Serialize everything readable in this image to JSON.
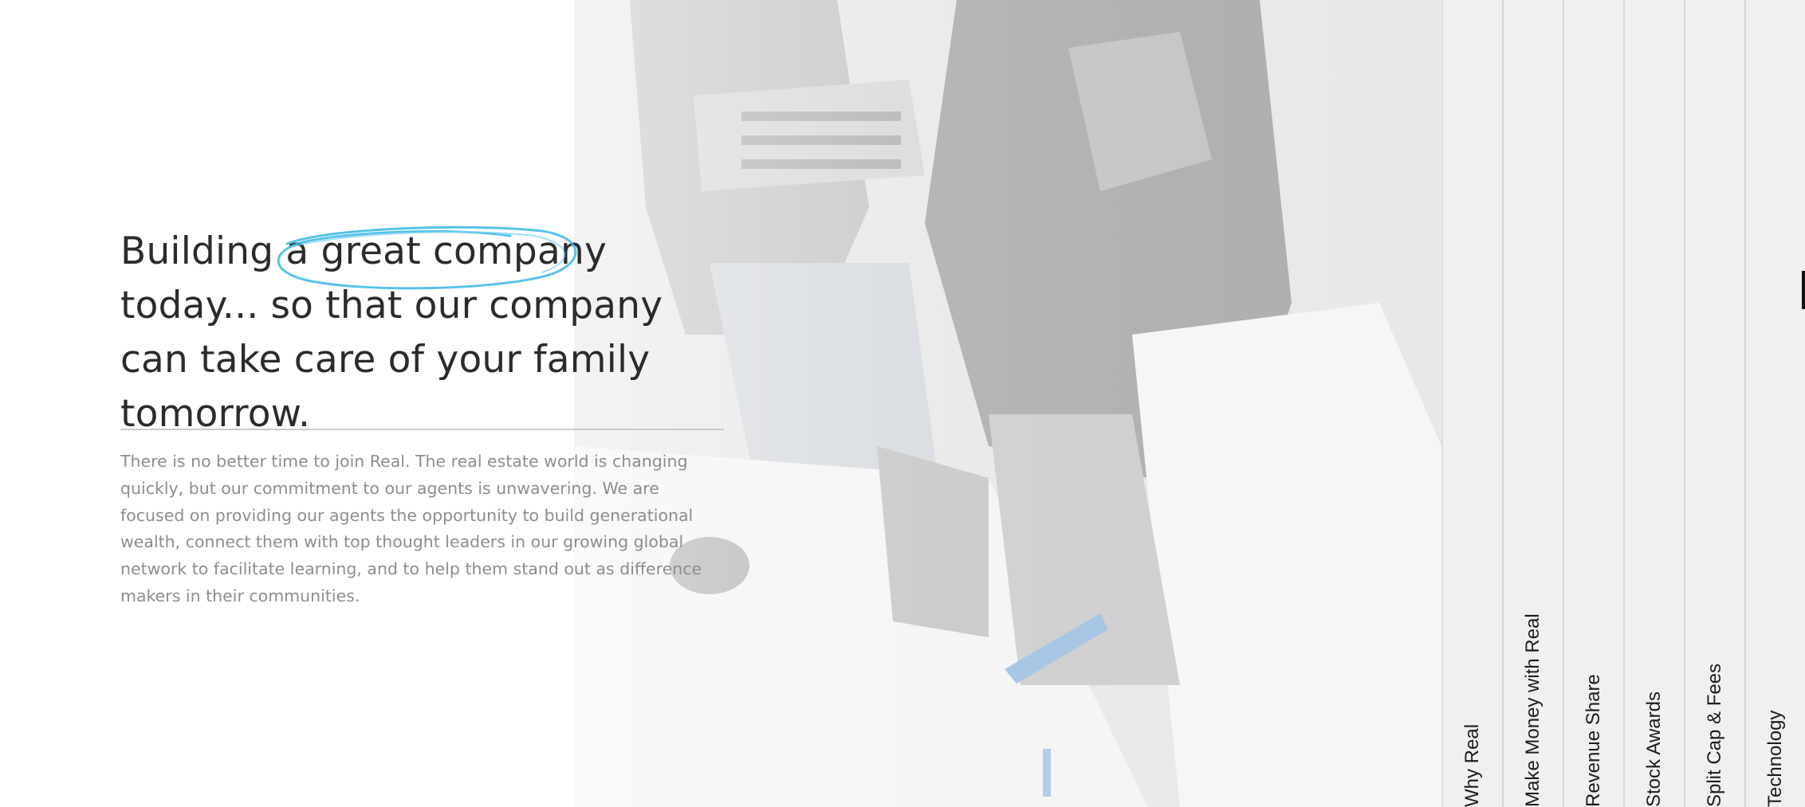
{
  "hero": {
    "headline_pre": "Building a ",
    "headline_highlight": "great company",
    "headline_post": " today... so that our company can take care of your family tomorrow.",
    "paragraph": "There is no better time to join Real. The real estate world is changing quickly, but our commitment to our agents is unwavering. We are focused on providing our agents the opportunity to build generational wealth, connect them with top thought leaders in our growing global network to facilitate learning, and to help them stand out as difference makers in their communities."
  },
  "side_nav": {
    "items": [
      {
        "label": "Why Real"
      },
      {
        "label": "Make Money with Real"
      },
      {
        "label": "Revenue Share"
      },
      {
        "label": "Stock Awards"
      },
      {
        "label": "Split Cap & Fees"
      },
      {
        "label": "Technology"
      }
    ]
  },
  "colors": {
    "accent_scribble": "#3ab7e6",
    "headline": "#2b2b2b",
    "body": "#8d8d8d"
  }
}
